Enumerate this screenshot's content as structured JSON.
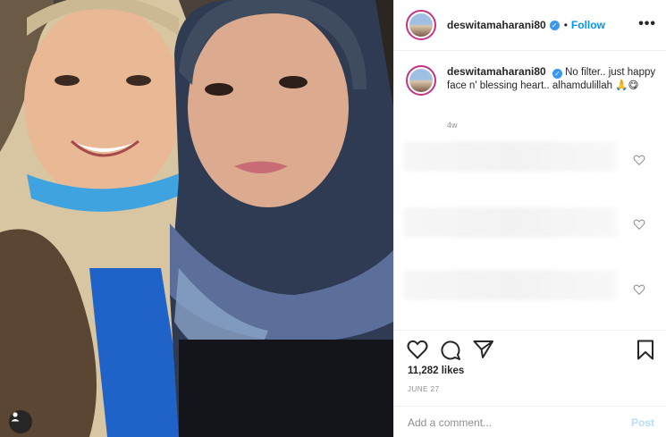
{
  "header": {
    "username": "deswitamaharani80",
    "verified_glyph": "✓",
    "separator": "•",
    "follow_label": "Follow",
    "more_label": "•••"
  },
  "caption": {
    "username": "deswitamaharani80",
    "text": "No filter.. just happy face n' blessing heart.. alhamdulillah 🙏😋",
    "time": "4w"
  },
  "post": {
    "likes": "11,282 likes",
    "date": "JUNE 27"
  },
  "comment": {
    "placeholder": "Add a comment...",
    "post_label": "Post"
  },
  "icons": {
    "like": "heart-icon",
    "comment": "comment-icon",
    "share": "share-icon",
    "save": "bookmark-icon",
    "user_tag": "user-tag-icon",
    "more": "more-options-icon"
  },
  "colors": {
    "follow": "#0095f6",
    "verified": "#3897f0",
    "post_disabled": "#b2dffc",
    "muted": "#8e8e8e"
  }
}
